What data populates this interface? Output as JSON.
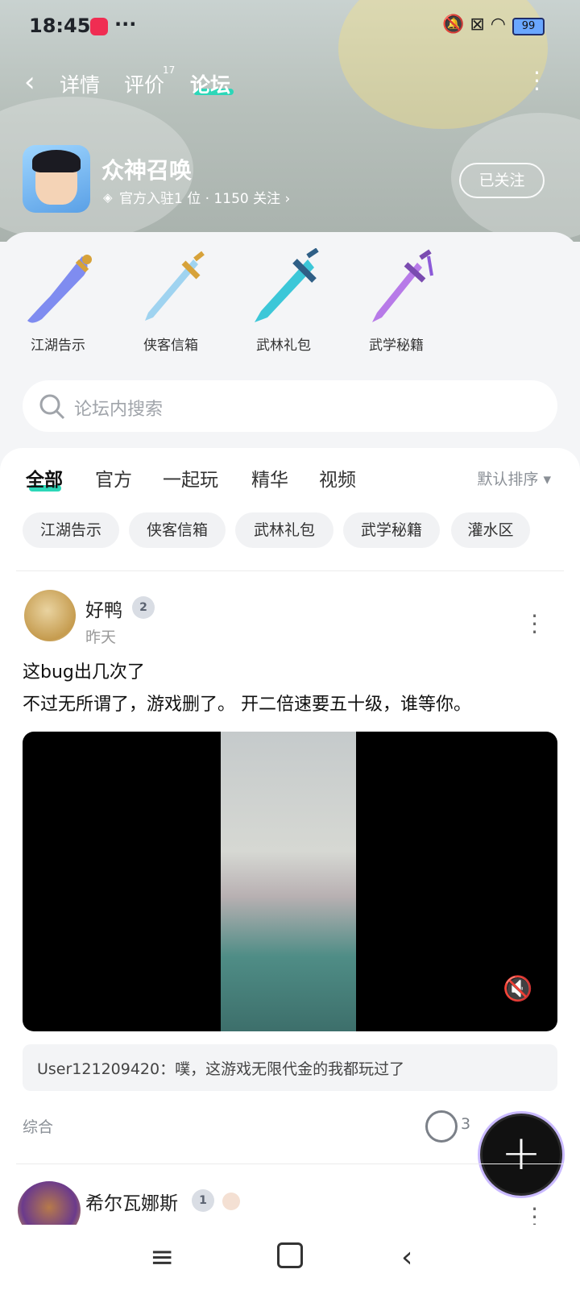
{
  "status_bar": {
    "time": "18:45",
    "more": "···",
    "battery": "99"
  },
  "nav": {
    "tabs": [
      {
        "label": "详情"
      },
      {
        "label": "评价",
        "badge": "17"
      },
      {
        "label": "论坛"
      }
    ]
  },
  "game": {
    "title": "众神召唤",
    "subtitle": "官方入驻1 位 · 1150 关注 ›",
    "follow_label": "已关注"
  },
  "categories": [
    {
      "label": "江湖告示",
      "icon": "scimitar-icon"
    },
    {
      "label": "侠客信箱",
      "icon": "sword-icon"
    },
    {
      "label": "武林礼包",
      "icon": "broad-sword-icon"
    },
    {
      "label": "武学秘籍",
      "icon": "purple-sword-icon"
    }
  ],
  "search": {
    "placeholder": "论坛内搜索"
  },
  "feed_tabs": {
    "items": [
      "全部",
      "官方",
      "一起玩",
      "精华",
      "视频"
    ],
    "sort": "默认排序 ▾"
  },
  "chips": [
    "江湖告示",
    "侠客信箱",
    "武林礼包",
    "武学秘籍",
    "灌水区"
  ],
  "post1": {
    "author": "好鸭",
    "level": "2",
    "time": "昨天",
    "line1": "这bug出几次了",
    "line2": "不过无所谓了，游戏删了。 开二倍速要五十级，谁等你。",
    "comment": "User121209420：噗，这游戏无限代金的我都玩过了",
    "tag": "综合",
    "comment_count": "3"
  },
  "post2": {
    "author": "希尔瓦娜斯",
    "level": "1"
  },
  "colors": {
    "accent": "#2cd7b8",
    "video_bg": "#000000"
  }
}
